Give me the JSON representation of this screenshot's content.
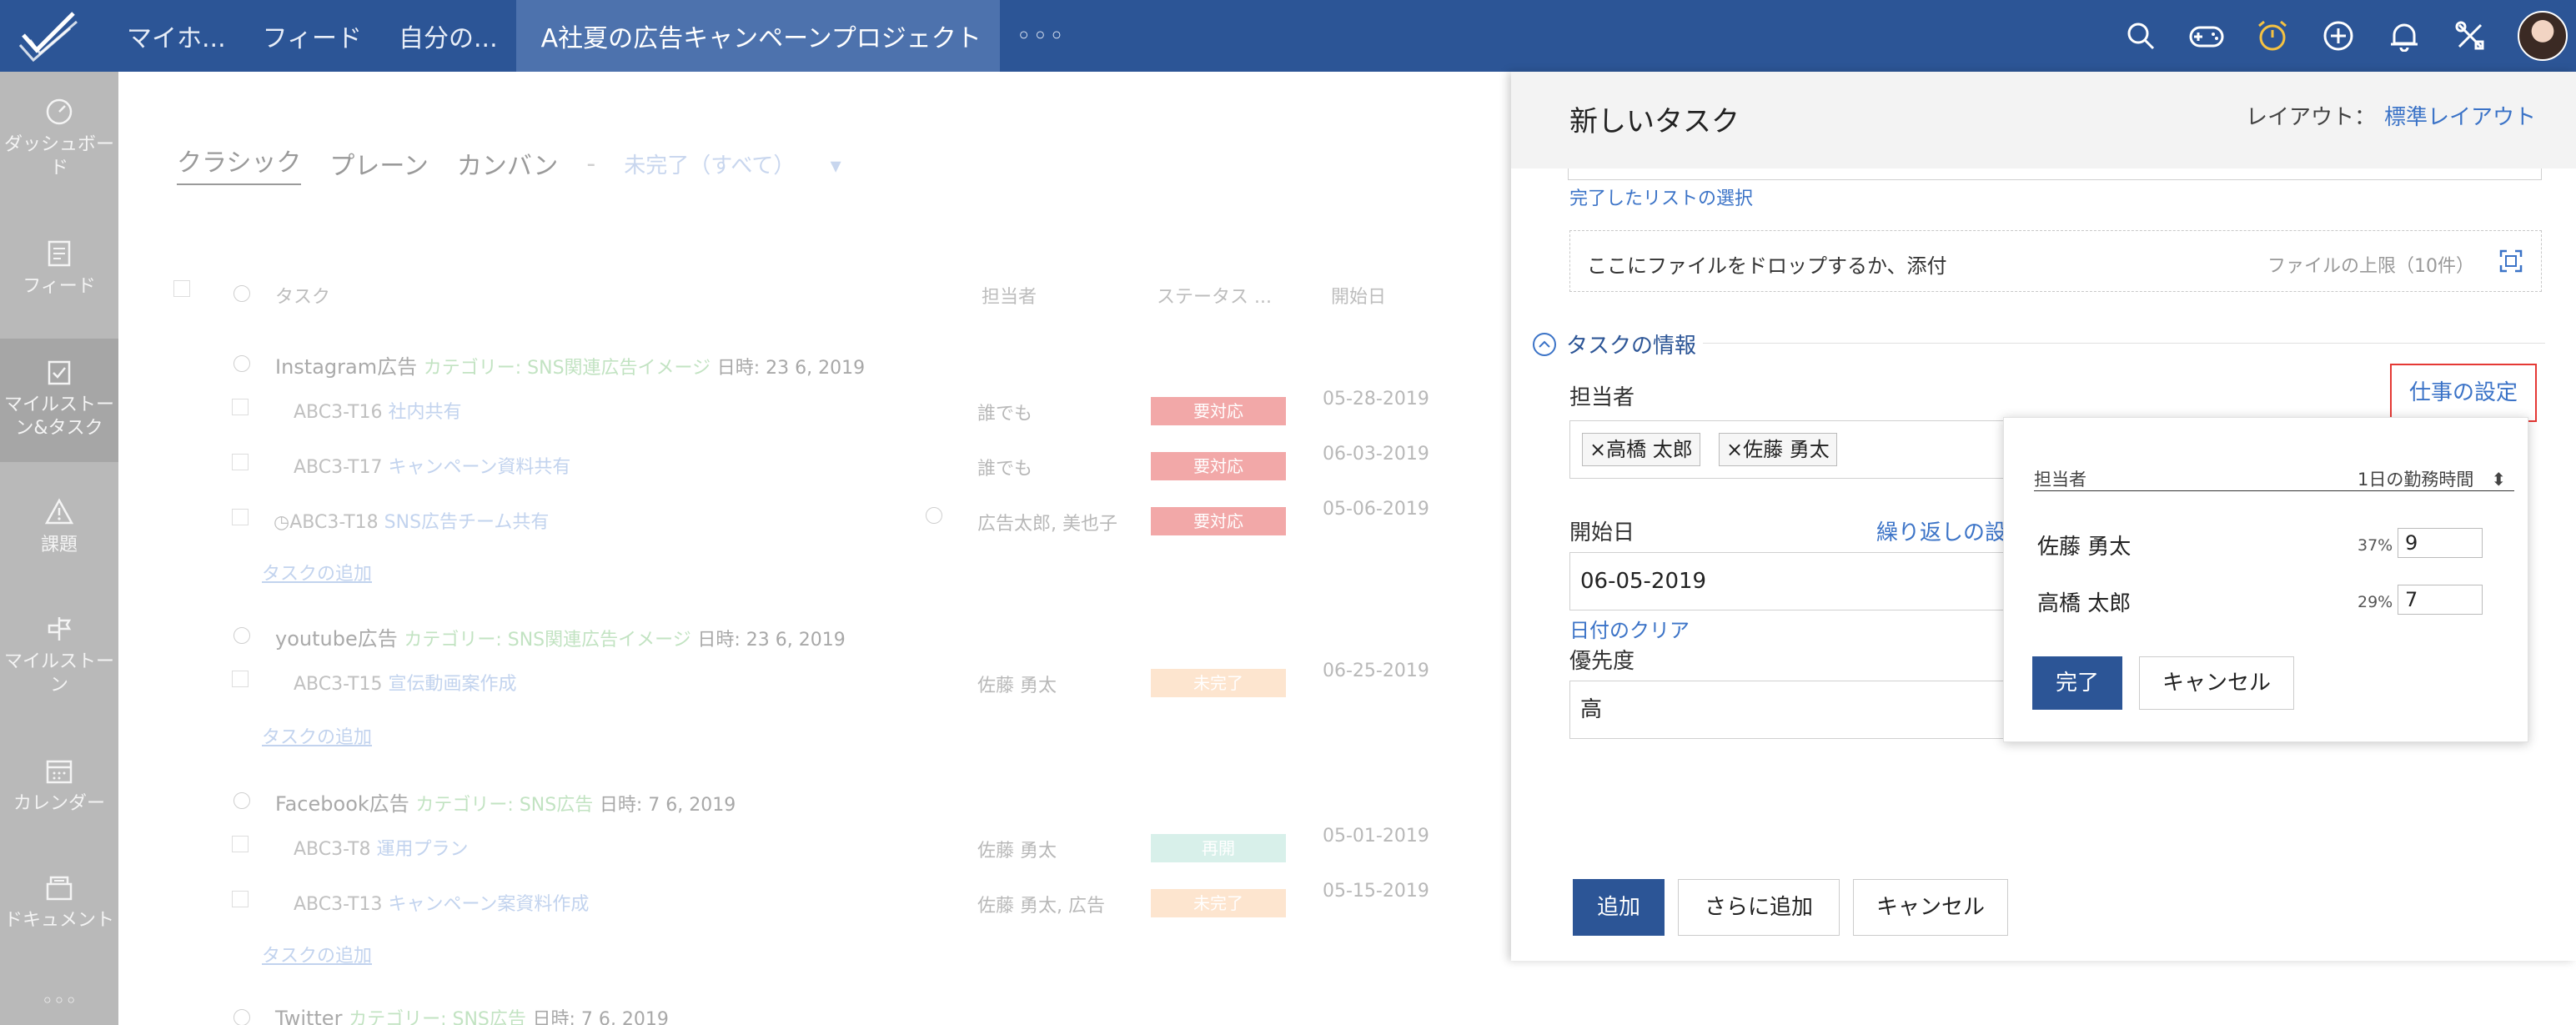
{
  "topbar": {
    "nav": [
      "マイホ...",
      "フィード",
      "自分の..."
    ],
    "project": "A社夏の広告キャンペーンプロジェクト",
    "more": "◦◦◦"
  },
  "sidebar": {
    "items": [
      {
        "label": "ダッシュボード",
        "icon": "dashboard-icon"
      },
      {
        "label": "フィード",
        "icon": "feed-icon"
      },
      {
        "label": "マイルストーン&タスク",
        "icon": "tasks-icon"
      },
      {
        "label": "課題",
        "icon": "issues-icon"
      },
      {
        "label": "マイルストーン",
        "icon": "milestone-icon"
      },
      {
        "label": "カレンダー",
        "icon": "calendar-icon"
      },
      {
        "label": "ドキュメント",
        "icon": "document-icon"
      }
    ],
    "more": "◦◦◦"
  },
  "main": {
    "views": [
      "クラシック",
      "プレーン",
      "カンバン",
      "-",
      "未完了（すべて）"
    ],
    "headers": [
      "タスク",
      "担当者",
      "ステータス ...",
      "開始日"
    ],
    "groups": [
      {
        "name": "Instagram広告",
        "category": "カテゴリー: SNS関連広告イメージ",
        "date": "日時: 23 6, 2019"
      },
      {
        "name": "youtube広告",
        "category": "カテゴリー: SNS関連広告イメージ",
        "date": "日時: 23 6, 2019"
      },
      {
        "name": "Facebook広告",
        "category": "カテゴリー: SNS広告",
        "date": "日時: 7 6, 2019"
      },
      {
        "name": "Twitter",
        "category": "カテゴリー: SNS広告",
        "date": "日時: 7 6, 2019"
      }
    ],
    "rows": [
      {
        "id": "ABC3-T16",
        "name": "社内共有",
        "owner": "誰でも",
        "status": "要対応",
        "start": "05-28-2019"
      },
      {
        "id": "ABC3-T17",
        "name": "キャンペーン資料共有",
        "owner": "誰でも",
        "status": "要対応",
        "start": "06-03-2019"
      },
      {
        "id": "ABC3-T18",
        "name": "SNS広告チーム共有",
        "owner": "広告太郎, 美也子",
        "status": "要対応",
        "start": "05-06-2019"
      },
      {
        "id": "ABC3-T15",
        "name": "宣伝動画案作成",
        "owner": "佐藤 勇太",
        "status": "未完了",
        "start": "06-25-2019"
      },
      {
        "id": "ABC3-T8",
        "name": "運用プラン",
        "owner": "佐藤 勇太",
        "status": "再開",
        "start": "05-01-2019"
      },
      {
        "id": "ABC3-T13",
        "name": "キャンペーン案資料作成",
        "owner": "佐藤 勇太, 広告",
        "status": "未完了",
        "start": "05-15-2019"
      }
    ],
    "add_task": "タスクの追加"
  },
  "panel": {
    "title": "新しいタスク",
    "layout_label": "レイアウト：",
    "layout_value": "標準レイアウト",
    "select_done_list": "完了したリストの選択",
    "drop_text": "ここにファイルをドロップするか、添付",
    "file_limit": "ファイルの上限（10件）",
    "section": "タスクの情報",
    "assignee_label": "担当者",
    "assignees": [
      "高橋 太郎",
      "佐藤 勇太"
    ],
    "work_setting": "仕事の設定",
    "start_label": "開始日",
    "repeat": "繰り返しの設",
    "start_value": "06-05-2019",
    "clear_date": "日付のクリア",
    "priority_label": "優先度",
    "priority_value": "高",
    "add": "追加",
    "add_more": "さらに追加",
    "cancel": "キャンセル"
  },
  "popup": {
    "col_assignee": "担当者",
    "col_hours": "1日の勤務時間",
    "rows": [
      {
        "name": "佐藤 勇太",
        "pct": "37%",
        "hours": "9"
      },
      {
        "name": "高橋 太郎",
        "pct": "29%",
        "hours": "7"
      }
    ],
    "done": "完了",
    "cancel": "キャンセル"
  },
  "colors": {
    "brand": "#2c5596",
    "link": "#3b73c7",
    "highlight": "#e53935"
  }
}
